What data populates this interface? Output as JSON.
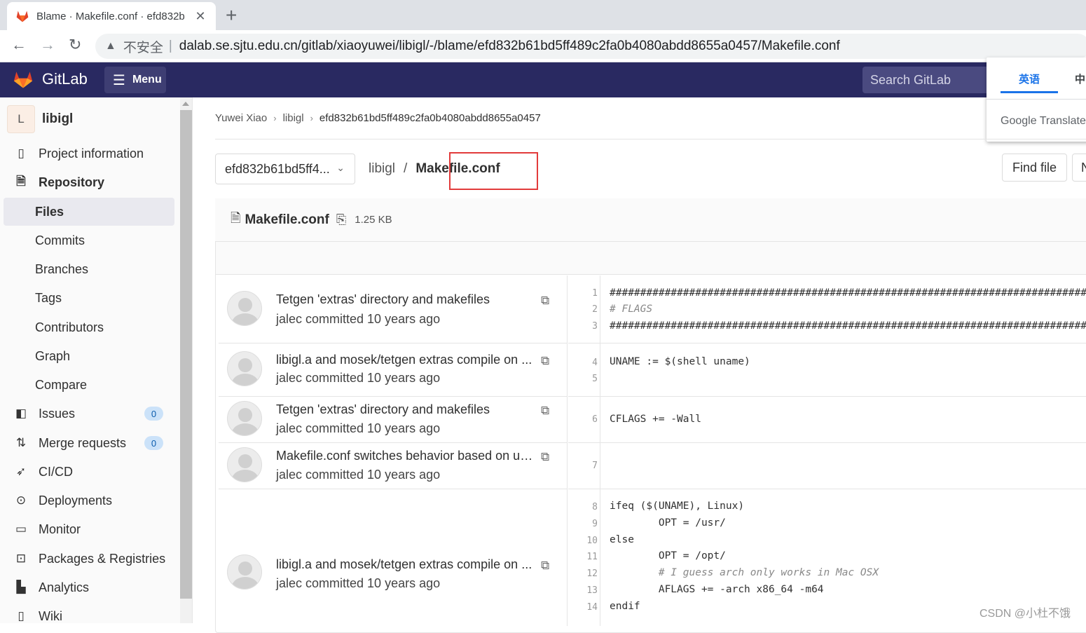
{
  "browser": {
    "tab_title": "Blame · Makefile.conf · efd832b",
    "insecure_label": "不安全",
    "url": "dalab.se.sjtu.edu.cn/gitlab/xiaoyuwei/libigl/-/blame/efd832b61bd5ff489c2fa0b4080abdd8655a0457/Makefile.conf"
  },
  "header": {
    "brand": "GitLab",
    "menu_label": "Menu",
    "search_placeholder": "Search GitLab"
  },
  "translate_popup": {
    "tab_active": "英语",
    "tab_other": "中",
    "brand": "Google Translate"
  },
  "sidebar": {
    "project_initial": "L",
    "project_name": "libigl",
    "items": [
      {
        "label": "Project information",
        "icon": "info-icon"
      },
      {
        "label": "Repository",
        "icon": "doc-icon"
      },
      {
        "label": "Files"
      },
      {
        "label": "Commits"
      },
      {
        "label": "Branches"
      },
      {
        "label": "Tags"
      },
      {
        "label": "Contributors"
      },
      {
        "label": "Graph"
      },
      {
        "label": "Compare"
      },
      {
        "label": "Issues",
        "icon": "issues-icon",
        "count": "0"
      },
      {
        "label": "Merge requests",
        "icon": "merge-icon",
        "count": "0"
      },
      {
        "label": "CI/CD",
        "icon": "rocket-icon"
      },
      {
        "label": "Deployments",
        "icon": "deploy-icon"
      },
      {
        "label": "Monitor",
        "icon": "monitor-icon"
      },
      {
        "label": "Packages & Registries",
        "icon": "package-icon"
      },
      {
        "label": "Analytics",
        "icon": "chart-icon"
      },
      {
        "label": "Wiki",
        "icon": "book-icon"
      }
    ]
  },
  "breadcrumb": [
    "Yuwei Xiao",
    "libigl",
    "efd832b61bd5ff489c2fa0b4080abdd8655a0457"
  ],
  "ref_selector": "efd832b61bd5ff4...",
  "path": {
    "repo": "libigl",
    "file": "Makefile.conf"
  },
  "actions": {
    "find_file": "Find file",
    "next": "N"
  },
  "file": {
    "name": "Makefile.conf",
    "size": "1.25 KB"
  },
  "blame": [
    {
      "message": "Tetgen 'extras' directory and makefiles",
      "meta": "jalec committed 10 years ago"
    },
    {
      "message": "libigl.a and mosek/tetgen extras compile on ...",
      "meta": "jalec committed 10 years ago"
    },
    {
      "message": "Tetgen 'extras' directory and makefiles",
      "meta": "jalec committed 10 years ago"
    },
    {
      "message": "Makefile.conf switches behavior based on user",
      "meta": "jalec committed 10 years ago"
    },
    {
      "message": "libigl.a and mosek/tetgen extras compile on ...",
      "meta": "jalec committed 10 years ago"
    }
  ],
  "code": [
    {
      "n": "1",
      "text": "##################################################################################"
    },
    {
      "n": "2",
      "text": "# FLAGS"
    },
    {
      "n": "3",
      "text": "##################################################################################"
    },
    {
      "n": "4",
      "text": "UNAME := $(shell uname)"
    },
    {
      "n": "5",
      "text": ""
    },
    {
      "n": "6",
      "text": "CFLAGS += -Wall"
    },
    {
      "n": "7",
      "text": ""
    },
    {
      "n": "8",
      "text": "ifeq ($(UNAME), Linux)"
    },
    {
      "n": "9",
      "text": "        OPT = /usr/"
    },
    {
      "n": "10",
      "text": "else"
    },
    {
      "n": "11",
      "text": "        OPT = /opt/"
    },
    {
      "n": "12",
      "text": "        # I guess arch only works in Mac OSX"
    },
    {
      "n": "13",
      "text": "        AFLAGS += -arch x86_64 -m64"
    },
    {
      "n": "14",
      "text": "endif"
    }
  ],
  "watermark": "CSDN @小杜不饿"
}
